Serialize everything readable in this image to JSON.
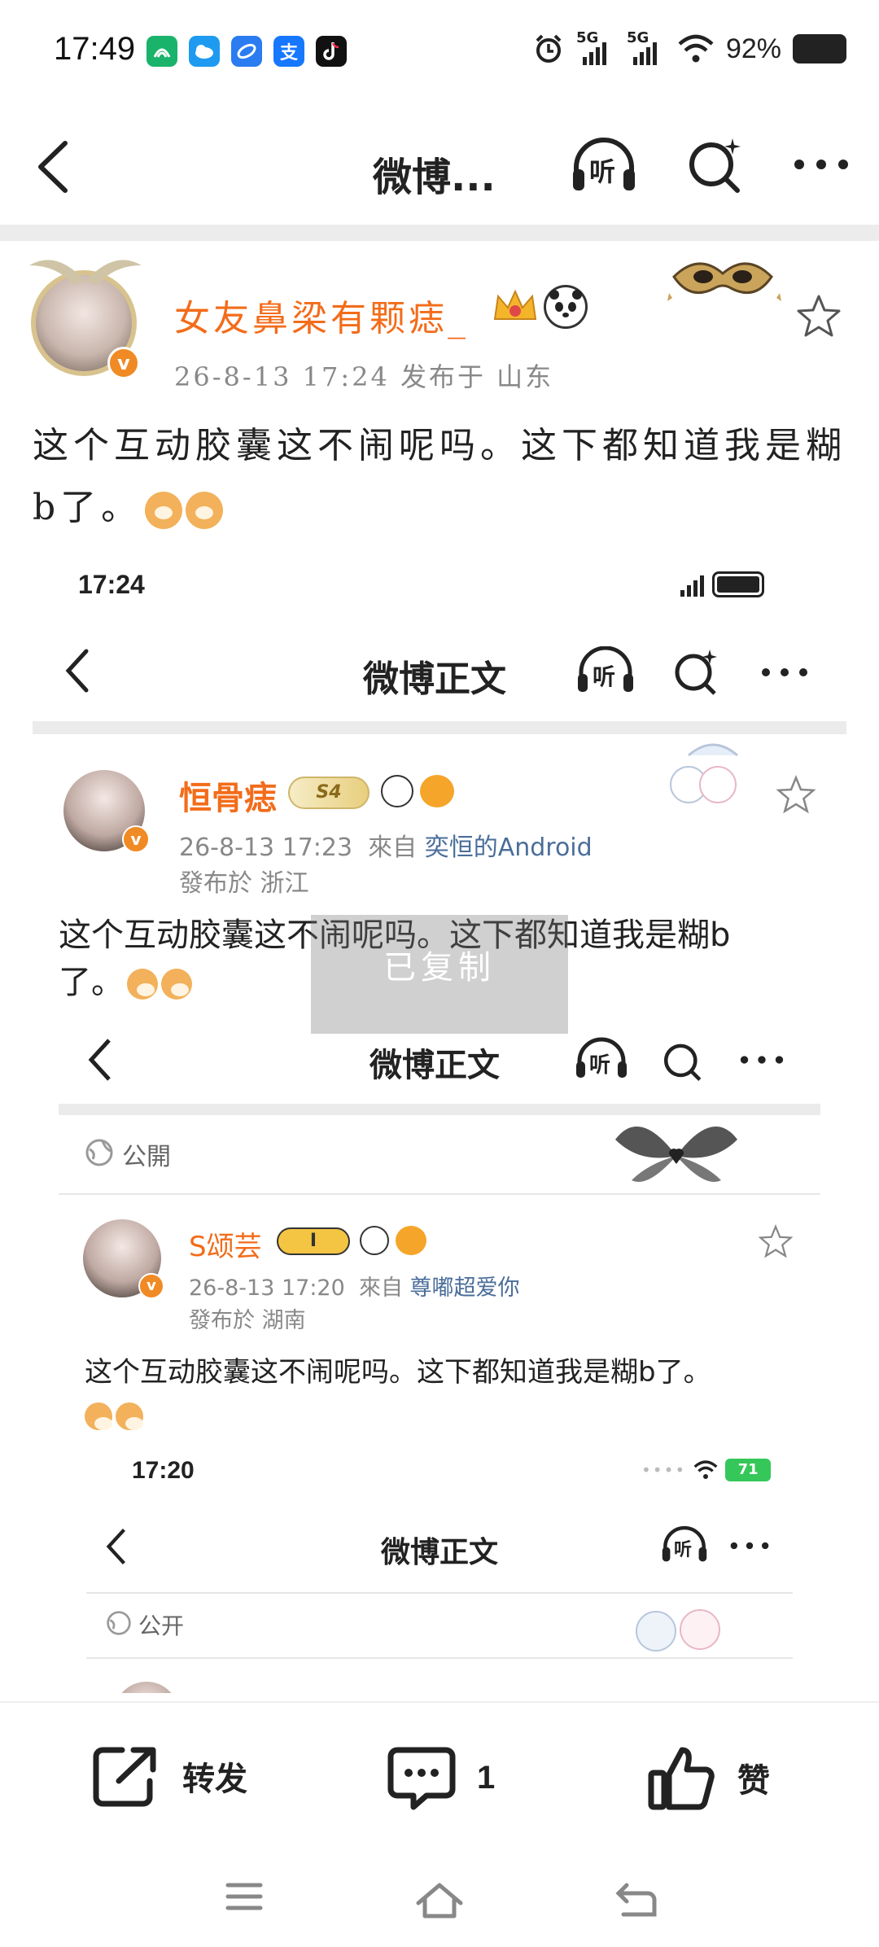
{
  "status_bar": {
    "time": "17:49",
    "battery_percent": "92%",
    "network_1": "5G",
    "network_2": "5G",
    "app_icons": [
      "app-green-icon",
      "weather-icon",
      "browser-icon",
      "alipay-icon",
      "tiktok-icon"
    ],
    "alipay_glyph": "支"
  },
  "nav": {
    "title": "微博...",
    "listen_label": "听"
  },
  "post": {
    "username": "女友鼻梁有颗痣_",
    "meta": "26-8-13 17:24  发布于 山东",
    "text": "这个互动胶囊这不闹呢吗。这下都知道我是糊b了。"
  },
  "embedded_1": {
    "status_time": "17:24",
    "title": "微博正文",
    "listen_label": "听",
    "username": "恒骨痣",
    "level_badge": "S4",
    "meta_date": "26-8-13 17:23",
    "meta_from": "來自",
    "meta_source": "奕恒的Android",
    "meta_location": "發布於 浙江",
    "text": "这个互动胶囊这不闹呢吗。这下都知道我是糊b了。"
  },
  "toast": {
    "label": "已复制"
  },
  "embedded_2": {
    "title": "微博正文",
    "listen_label": "听",
    "visibility": "公開",
    "username": "S颂芸",
    "level_badge": "I",
    "meta_date": "26-8-13 17:20",
    "meta_from": "來自",
    "meta_source": "尊嘟超爱你",
    "meta_location": "發布於 湖南",
    "text": "这个互动胶囊这不闹呢吗。这下都知道我是糊b了。"
  },
  "embedded_3": {
    "status_time": "17:20",
    "battery": "71",
    "title": "微博正文",
    "listen_label": "听",
    "visibility": "公开"
  },
  "actions": {
    "repost_label": "转发",
    "comment_count": "1",
    "like_label": "赞"
  },
  "colors": {
    "accent_orange": "#f36c1a",
    "link_blue": "#4a6d9a",
    "meta_grey": "#888888"
  }
}
